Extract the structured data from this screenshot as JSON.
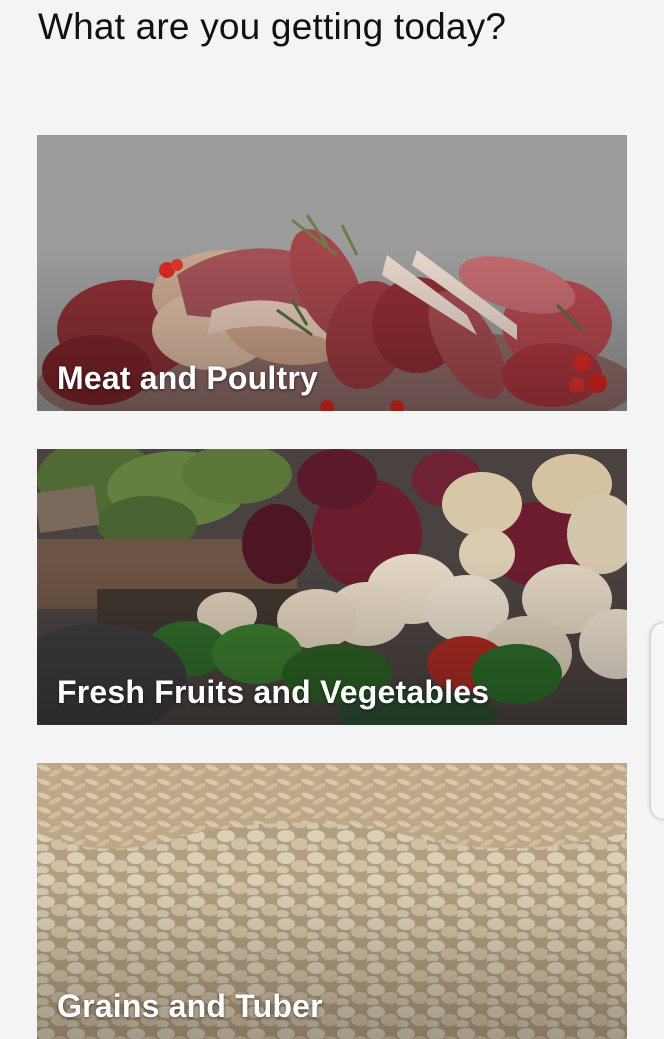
{
  "header": {
    "title": "What are you getting today?"
  },
  "categories": [
    {
      "label": "Meat and Poultry",
      "icon": "meat-poultry-image"
    },
    {
      "label": "Fresh Fruits and Vegetables",
      "icon": "fruits-vegetables-image"
    },
    {
      "label": "Grains and Tuber",
      "icon": "grains-tuber-image"
    }
  ],
  "colors": {
    "background": "#f4f4f4",
    "title_text": "#111111",
    "card_label_text": "#ffffff"
  }
}
